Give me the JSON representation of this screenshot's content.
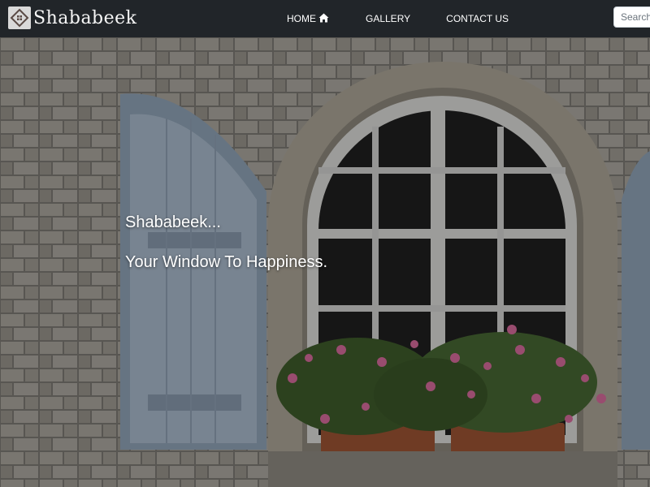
{
  "navbar": {
    "brand": "Shababeek",
    "logo_icon": "window-house-icon",
    "links": [
      {
        "label": "HOME",
        "icon": "home-icon"
      },
      {
        "label": "GALLERY"
      },
      {
        "label": "CONTACT US"
      }
    ],
    "search_placeholder": "Search"
  },
  "hero": {
    "title": "Shababeek...",
    "tagline": "Your Window To Happiness.",
    "background": "stone-wall-arched-window-with-shutters-and-flower-boxes"
  },
  "colors": {
    "navbar_bg": "#212529",
    "nav_text": "#ffffff",
    "hero_text": "#ffffff"
  }
}
